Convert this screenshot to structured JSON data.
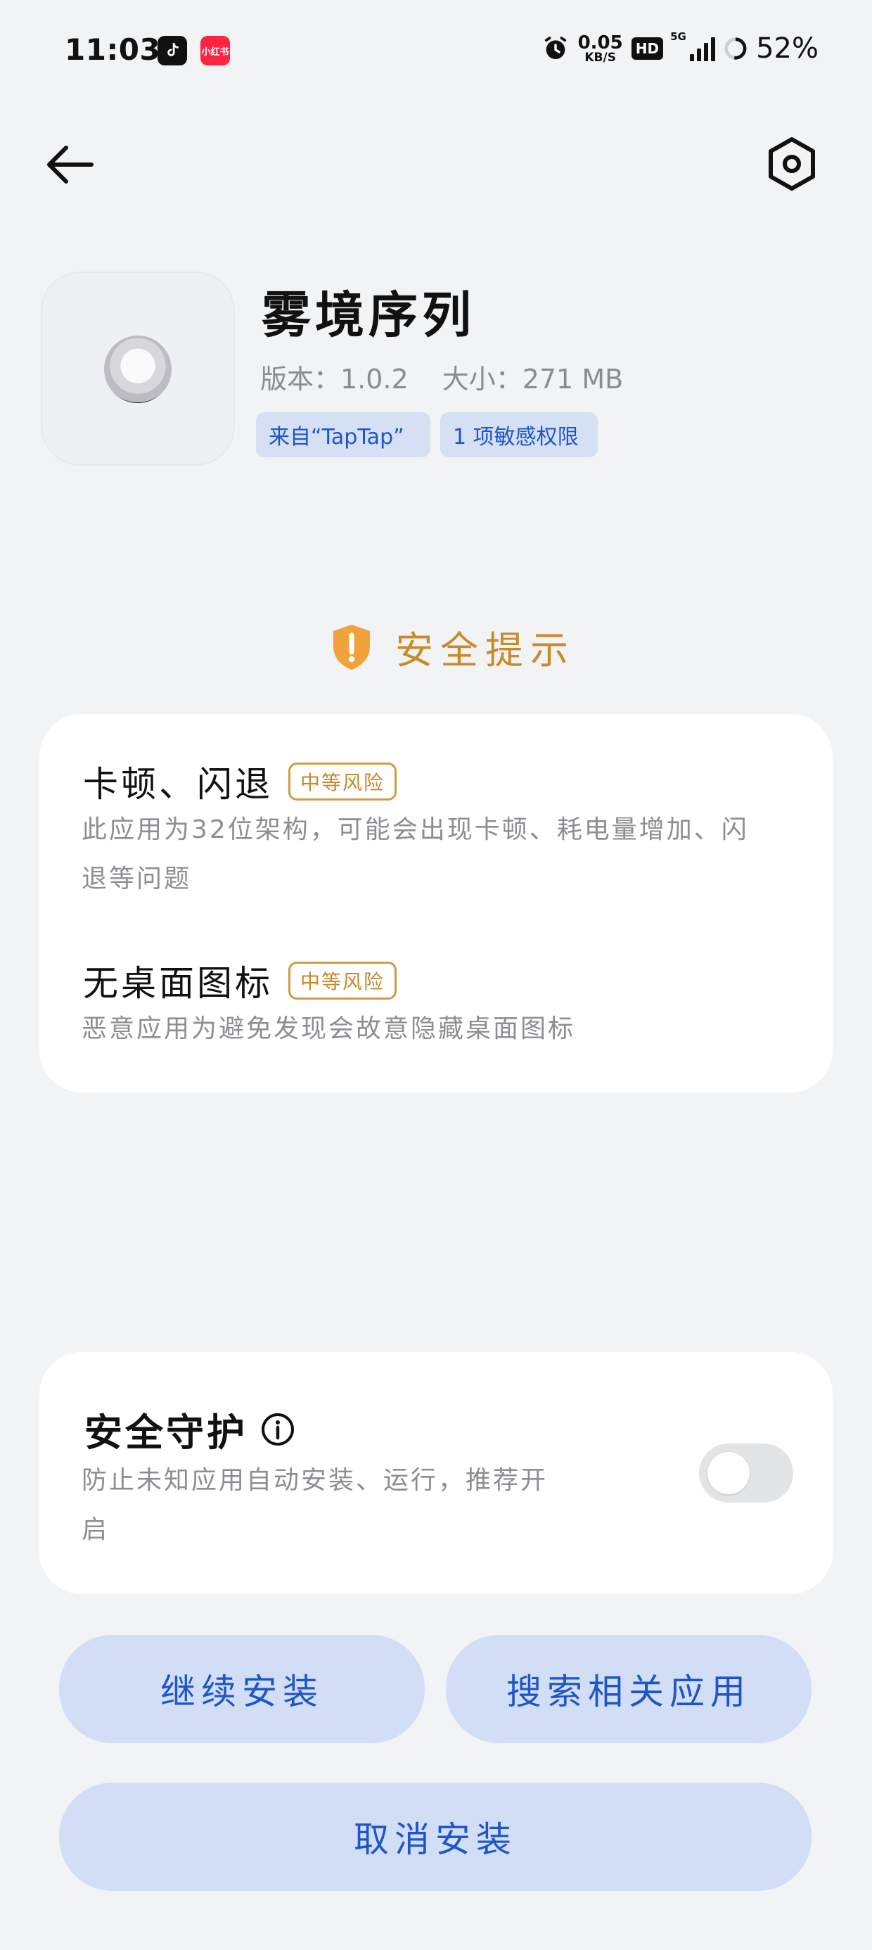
{
  "status_bar": {
    "time": "11:03",
    "app_icons": [
      "tiktok-icon",
      "xiaohongshu-icon"
    ],
    "xiaohongshu_label": "小红书",
    "net_speed_value": "0.05",
    "net_speed_unit": "KB/S",
    "hd_label": "HD",
    "network_label": "5G",
    "battery_percent": "52%"
  },
  "nav": {
    "back_icon": "arrow-left-icon",
    "settings_icon": "hexagon-gear-icon"
  },
  "app": {
    "name": "雾境序列",
    "version": "版本：1.0.2",
    "size": "大小：271 MB",
    "source_chip": "来自“TapTap”",
    "permission_chip": "1 项敏感权限"
  },
  "security_tip": {
    "title": "安全提示",
    "icon": "shield-exclamation-icon",
    "accent": "#c98a28",
    "items": [
      {
        "title": "卡顿、闪退",
        "risk": "中等风险",
        "desc_line1": "此应用为32位架构，可能会出现卡顿、耗电量增加、闪",
        "desc_line2": "退等问题"
      },
      {
        "title": "无桌面图标",
        "risk": "中等风险",
        "desc_line1": "恶意应用为避免发现会故意隐藏桌面图标"
      }
    ]
  },
  "protection": {
    "title": "安全守护",
    "desc_line1": "防止未知应用自动安装、运行，推荐开",
    "desc_line2": "启",
    "enabled": false
  },
  "buttons": {
    "continue": "继续安装",
    "search": "搜索相关应用",
    "cancel": "取消安装",
    "color": "#1e55c8"
  }
}
